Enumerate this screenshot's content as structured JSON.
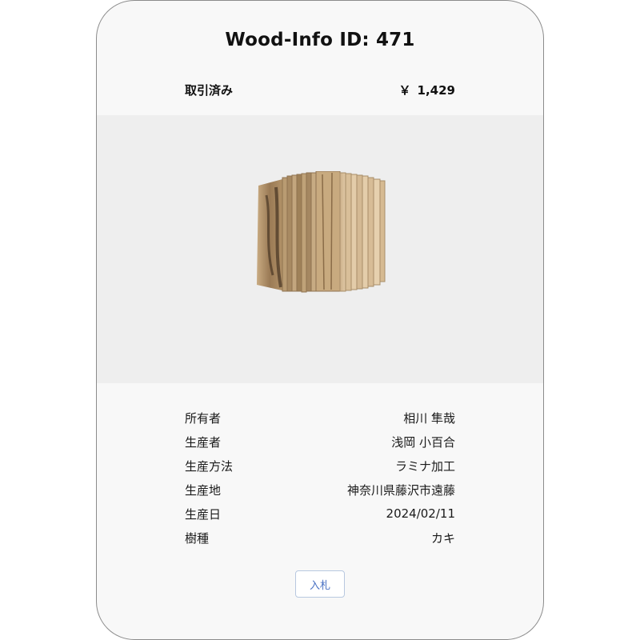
{
  "card": {
    "title": "Wood-Info ID: 471",
    "status": "取引済み",
    "price_currency": "￥",
    "price_value": "1,429"
  },
  "product_image": {
    "icon": "laminated-wood-block-image"
  },
  "details": [
    {
      "label": "所有者",
      "value": "相川 隼哉"
    },
    {
      "label": "生産者",
      "value": "浅岡 小百合"
    },
    {
      "label": "生産方法",
      "value": "ラミナ加工"
    },
    {
      "label": "生産地",
      "value": "神奈川県藤沢市遠藤"
    },
    {
      "label": "生産日",
      "value": "2024/02/11"
    },
    {
      "label": "樹種",
      "value": "カキ"
    }
  ],
  "actions": {
    "bid_label": "入札"
  },
  "colors": {
    "accent": "#4a72c4",
    "card_background": "#f8f8f8",
    "image_background": "#eeeeee"
  }
}
